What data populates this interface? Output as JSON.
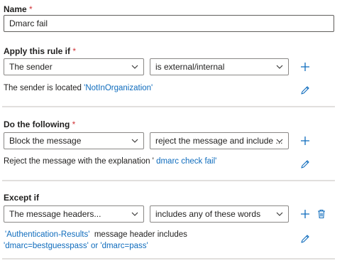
{
  "name": {
    "label": "Name",
    "required_mark": "*",
    "value": "Dmarc fail"
  },
  "condition": {
    "label": "Apply this rule if",
    "required_mark": "*",
    "dropdown1": "The sender",
    "dropdown2": "is external/internal",
    "desc_text": "The sender is located ",
    "desc_link": "'NotInOrganization'"
  },
  "action": {
    "label": "Do the following",
    "required_mark": "*",
    "dropdown1": "Block the message",
    "dropdown2": "reject the message and include ...",
    "desc_text": "Reject the message with the explanation ' ",
    "desc_link": "dmarc check fail'"
  },
  "exception": {
    "label": "Except if",
    "dropdown1": "The message headers...",
    "dropdown2": "includes any of these words",
    "desc_link1": "'Authentication-Results'",
    "desc_text1": "  message header includes",
    "desc_link2": "'dmarc=bestguesspass' or 'dmarc=pass'"
  },
  "colors": {
    "accent": "#0f6cbd",
    "required": "#d13438",
    "divider": "#e1dfdd"
  },
  "icons": [
    "chevron-down-icon",
    "add-icon",
    "edit-icon",
    "delete-icon"
  ]
}
